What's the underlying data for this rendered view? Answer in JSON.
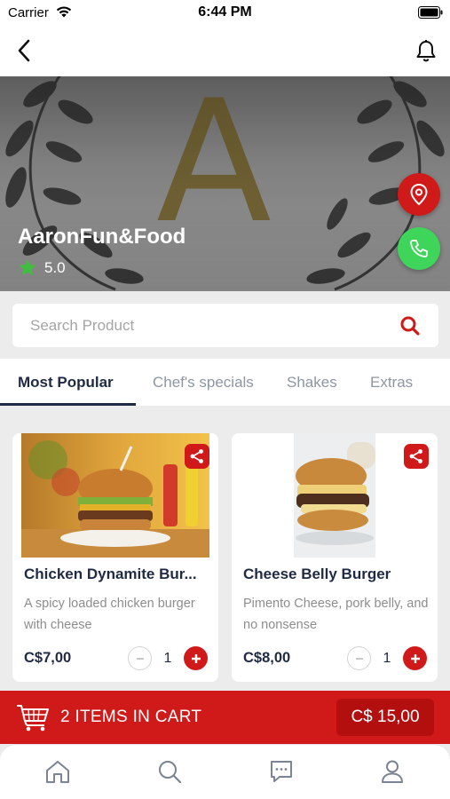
{
  "status": {
    "carrier": "Carrier",
    "time": "6:44 PM"
  },
  "icons": {
    "back": "chevron-left-icon",
    "bell": "bell-icon",
    "location": "map-pin-icon",
    "phone": "phone-icon",
    "search": "search-icon",
    "share": "share-icon",
    "cart": "shopping-cart-icon",
    "home": "home-icon",
    "search_tab": "search-icon",
    "messages": "message-icon",
    "profile": "user-icon"
  },
  "colors": {
    "accent": "#d01919",
    "call": "#3fd45a",
    "text_dark": "#1f2a44",
    "rating_star": "#3fbe3f"
  },
  "restaurant": {
    "logo_letter": "A",
    "name": "AaronFun&Food",
    "rating": "5.0"
  },
  "search": {
    "placeholder": "Search Product"
  },
  "tabs": [
    {
      "label": "Most Popular",
      "active": true
    },
    {
      "label": "Chef's specials",
      "active": false
    },
    {
      "label": "Shakes",
      "active": false
    },
    {
      "label": "Extras",
      "active": false
    }
  ],
  "products": [
    {
      "title": "Chicken Dynamite Bur...",
      "desc": "A spicy loaded chicken burger with cheese",
      "price": "C$7,00",
      "qty": "1"
    },
    {
      "title": "Cheese Belly Burger",
      "desc": "Pimento Cheese, pork belly, and no nonsense",
      "price": "C$8,00",
      "qty": "1"
    }
  ],
  "cart": {
    "label": "2 ITEMS  IN CART",
    "total": "C$ 15,00"
  }
}
